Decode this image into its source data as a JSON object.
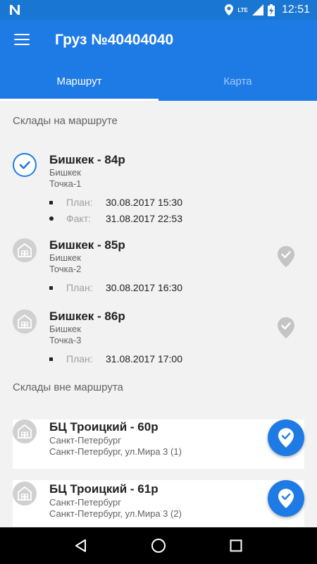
{
  "status_bar": {
    "time": "12:51",
    "network_label": "LTE",
    "icons": [
      "n-logo-icon",
      "location-icon",
      "signal-icon",
      "battery-charging-icon"
    ]
  },
  "app_bar": {
    "title": "Груз №40404040",
    "menu_icon": "hamburger-menu-icon"
  },
  "tabs": [
    {
      "label": "Маршрут",
      "active": true
    },
    {
      "label": "Карта",
      "active": false
    }
  ],
  "route_section": {
    "title": "Склады на маршруте",
    "items": [
      {
        "title": "Бишкек - 84р",
        "city": "Бишкек",
        "point": "Точка-1",
        "status": "done",
        "plan_label": "План:",
        "plan_value": "30.08.2017 15:30",
        "fact_label": "Факт:",
        "fact_value": "31.08.2017 22:53"
      },
      {
        "title": "Бишкек - 85р",
        "city": "Бишкек",
        "point": "Точка-2",
        "status": "pending",
        "plan_label": "План:",
        "plan_value": "30.08.2017 16:30"
      },
      {
        "title": "Бишкек - 86р",
        "city": "Бишкек",
        "point": "Точка-3",
        "status": "pending",
        "plan_label": "План:",
        "plan_value": "31.08.2017 17:00"
      }
    ]
  },
  "off_route_section": {
    "title": "Склады вне маршрута",
    "items": [
      {
        "title": "БЦ Троицкий - 60р",
        "city": "Санкт-Петербург",
        "address": "Санкт-Петербург, ул.Мира 3 (1)"
      },
      {
        "title": "БЦ Троицкий - 61р",
        "city": "Санкт-Петербург",
        "address": "Санкт-Петербург, ул.Мира 3 (2)"
      }
    ]
  },
  "colors": {
    "primary": "#1e7be6",
    "status_bar": "#1976d2",
    "muted_icon": "#d0d0d0"
  },
  "nav_bar": {
    "icons": [
      "back-triangle-icon",
      "home-circle-icon",
      "recents-square-icon"
    ]
  }
}
